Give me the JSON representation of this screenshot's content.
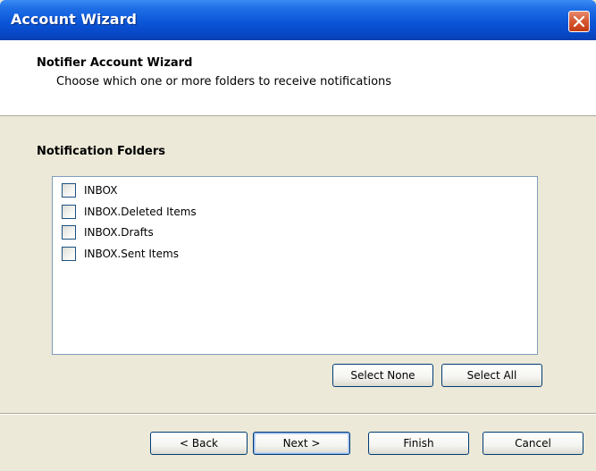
{
  "window": {
    "title": "Account Wizard",
    "close_icon": "close-icon"
  },
  "header": {
    "title": "Notifier Account Wizard",
    "subtitle": "Choose which one or more folders to receive notifications"
  },
  "folders": {
    "label": "Notification Folders",
    "items": [
      {
        "label": "INBOX",
        "checked": false
      },
      {
        "label": "INBOX.Deleted Items",
        "checked": false
      },
      {
        "label": "INBOX.Drafts",
        "checked": false
      },
      {
        "label": "INBOX.Sent Items",
        "checked": false
      }
    ],
    "select_none_label": "Select None",
    "select_all_label": "Select All"
  },
  "footer": {
    "back_label": "< Back",
    "next_label": "Next >",
    "finish_label": "Finish",
    "cancel_label": "Cancel"
  },
  "colors": {
    "titlebar": "#0a56d8",
    "background": "#ece9d8",
    "close": "#d6572f"
  }
}
